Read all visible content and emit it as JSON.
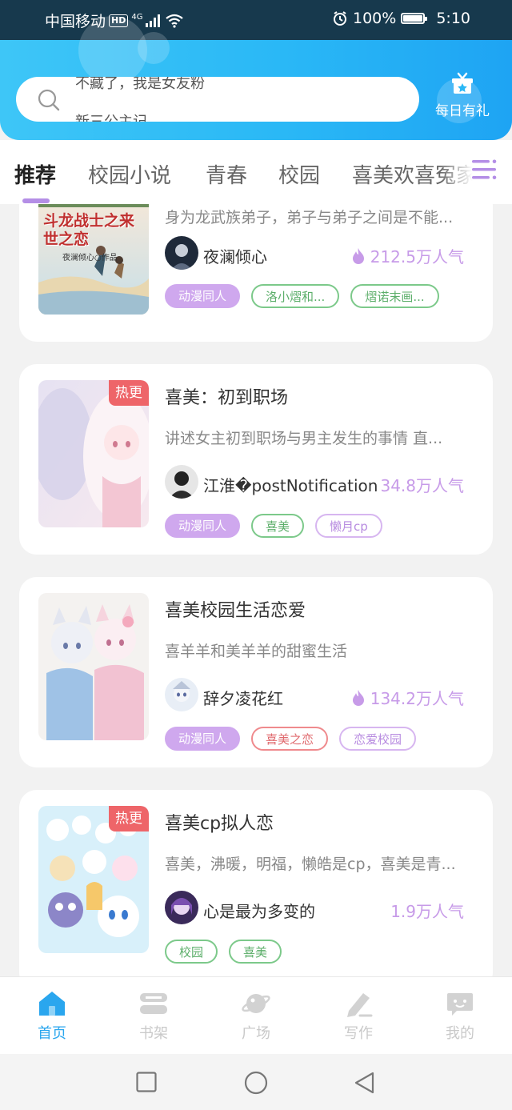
{
  "status_bar": {
    "carrier": "中国移动",
    "hd": "HD",
    "network": "4G",
    "battery_text": "100%",
    "time": "5:10"
  },
  "header": {
    "search_line_1": "不藏了，我是女友粉",
    "search_line_2": "新三公主记",
    "daily_gift_label": "每日有礼"
  },
  "tabs": [
    "推荐",
    "校园小说",
    "青春",
    "校园",
    "喜美欢喜冤家"
  ],
  "cards": [
    {
      "title": "",
      "cover_text": "斗龙战士之来世之恋",
      "cover_sub": "夜澜倾心○作品",
      "hot": "",
      "description": "身为龙武族弟子，弟子与弟子之间是不能...",
      "author": "夜澜倾心",
      "popularity": "212.5万人气",
      "tags": [
        {
          "label": "动漫同人",
          "style": "filled"
        },
        {
          "label": "洛小熠和...",
          "style": "green"
        },
        {
          "label": "熠诺末画...",
          "style": "green"
        }
      ]
    },
    {
      "title": "喜美：初到职场",
      "hot": "热更",
      "description": "讲述女主初到职场与男主发生的事情 直...",
      "author": "江淮�postNotification",
      "popularity": "34.8万人气",
      "tags": [
        {
          "label": "动漫同人",
          "style": "filled"
        },
        {
          "label": "喜美",
          "style": "green"
        },
        {
          "label": "懒月cp",
          "style": "purple"
        }
      ]
    },
    {
      "title": "喜美校园生活恋爱",
      "hot": "",
      "description": "喜羊羊和美羊羊的甜蜜生活",
      "author": "辞夕凌花红",
      "popularity": "134.2万人气",
      "tags": [
        {
          "label": "动漫同人",
          "style": "filled"
        },
        {
          "label": "喜美之恋",
          "style": "red"
        },
        {
          "label": "恋爱校园",
          "style": "purple"
        }
      ]
    },
    {
      "title": "喜美cp拟人恋",
      "hot": "热更",
      "description": "喜美，沸暖，明福，懒皓是cp，喜美是青...",
      "author": "心是最为多变的",
      "popularity": "1.9万人气",
      "tags": [
        {
          "label": "校园",
          "style": "green"
        },
        {
          "label": "喜美",
          "style": "green"
        }
      ]
    }
  ],
  "bottom_nav": [
    "首页",
    "书架",
    "广场",
    "写作",
    "我的"
  ],
  "colors": {
    "accent_blue": "#2aa6ee",
    "accent_purple": "#c79be8",
    "hot_red": "#ee6569"
  }
}
